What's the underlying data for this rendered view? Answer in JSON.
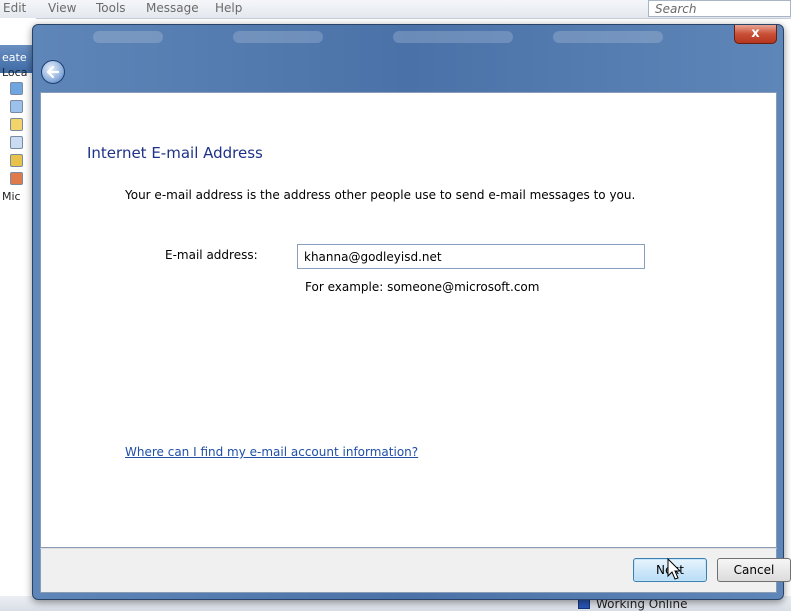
{
  "background_app": {
    "menu": [
      "Edit",
      "View",
      "Tools",
      "Message",
      "Help"
    ],
    "search_placeholder": "Search",
    "side_title": "eate",
    "side_labels": [
      "Loca",
      "Mic"
    ],
    "status_text": "Working Online"
  },
  "wizard": {
    "close_glyph": "x",
    "heading": "Internet E-mail Address",
    "description": "Your e-mail address is the address other people use to send e-mail messages to you.",
    "email_label": "E-mail address:",
    "email_value": "khanna@godleyisd.net",
    "example_text": "For example: someone@microsoft.com",
    "help_link": "Where can I find my e-mail account information?",
    "next_label": "Next",
    "cancel_label": "Cancel"
  },
  "colors": {
    "heading": "#1e3287",
    "link": "#1f4fa6",
    "titlebar": "#4a72a8",
    "close_button": "#c94f36"
  },
  "icons": [
    "back-arrow-icon",
    "close-icon",
    "mouse-pointer-icon",
    "status-network-icon"
  ]
}
